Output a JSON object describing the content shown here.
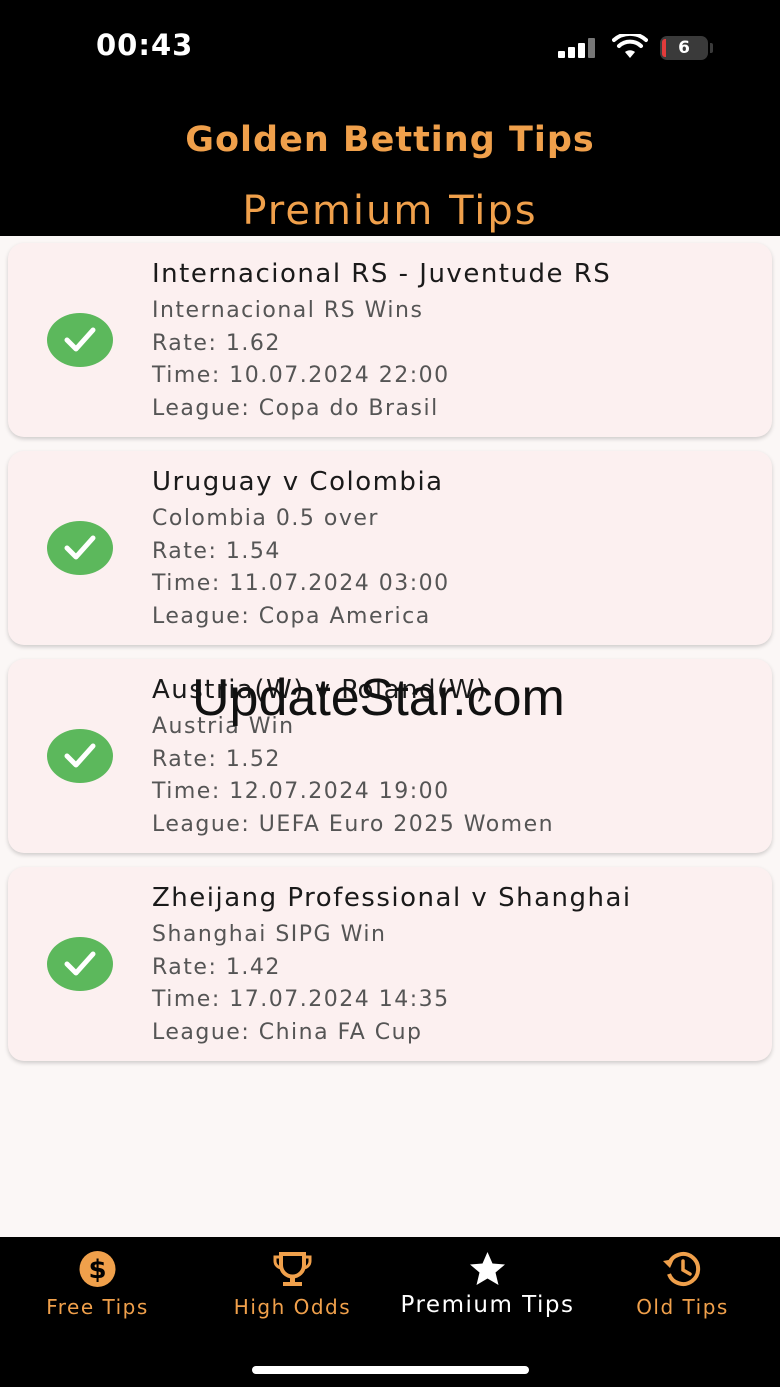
{
  "status_bar": {
    "time": "00:43",
    "battery": "6"
  },
  "header": {
    "app_title": "Golden Betting Tips",
    "page_title": "Premium Tips"
  },
  "tips": [
    {
      "match": "Internacional RS - Juventude RS",
      "prediction": "Internacional RS Wins",
      "rate": "Rate: 1.62",
      "time": "Time: 10.07.2024 22:00",
      "league": "League: Copa do Brasil",
      "status": "won"
    },
    {
      "match": "Uruguay v Colombia",
      "prediction": "Colombia 0.5 over",
      "rate": "Rate: 1.54",
      "time": "Time: 11.07.2024 03:00",
      "league": "League: Copa America",
      "status": "won"
    },
    {
      "match": "Austria(W) v Poland(W)",
      "prediction": "Austria Win",
      "rate": "Rate: 1.52",
      "time": "Time: 12.07.2024 19:00",
      "league": "League: UEFA Euro 2025 Women",
      "status": "won"
    },
    {
      "match": "Zheijang Professional v Shanghai",
      "prediction": "Shanghai SIPG Win",
      "rate": "Rate: 1.42",
      "time": "Time: 17.07.2024 14:35",
      "league": "League: China FA Cup",
      "status": "won"
    }
  ],
  "watermark": "UpdateStar.com",
  "tabs": [
    {
      "label": "Free Tips",
      "icon": "dollar-icon",
      "active": false
    },
    {
      "label": "High Odds",
      "icon": "trophy-icon",
      "active": false
    },
    {
      "label": "Premium Tips",
      "icon": "star-icon",
      "active": true
    },
    {
      "label": "Old Tips",
      "icon": "history-icon",
      "active": false
    }
  ],
  "colors": {
    "accent": "#f0a04b",
    "success": "#5cb85c",
    "card_bg": "#fcf0f0",
    "bar_bg": "#000000"
  }
}
